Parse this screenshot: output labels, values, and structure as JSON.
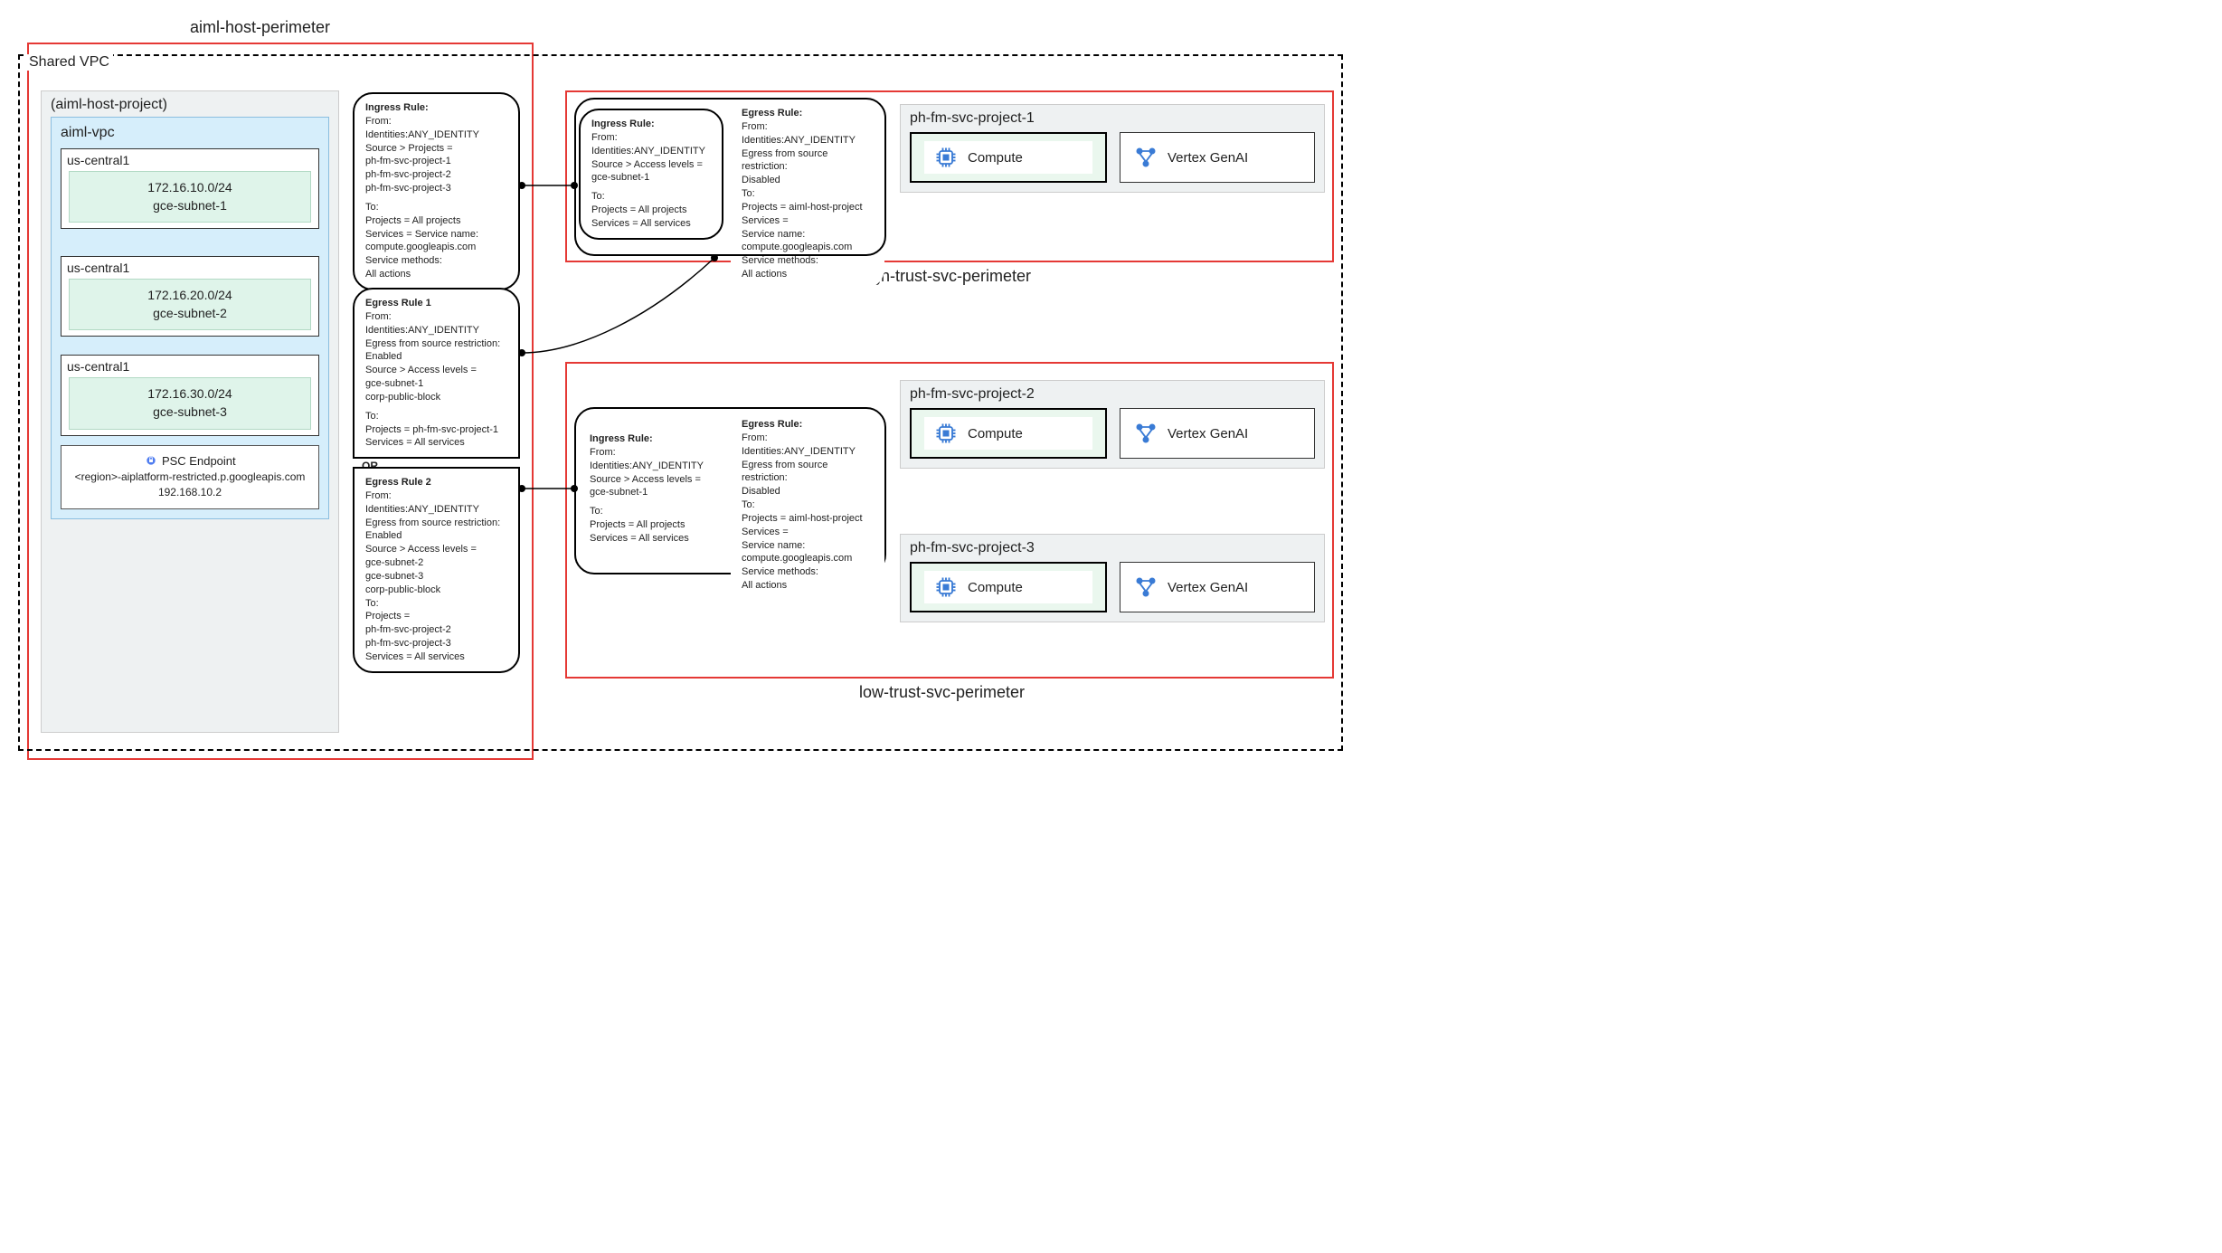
{
  "perimeters": {
    "host_label": "aiml-host-perimeter",
    "high_trust_label": "high-trust-svc-perimeter",
    "low_trust_label": "low-trust-svc-perimeter"
  },
  "shared_vpc": {
    "title": "Shared VPC",
    "host_project": {
      "title": "(aiml-host-project)",
      "vpc": {
        "title": "aiml-vpc",
        "subnets": [
          {
            "region": "us-central1",
            "cidr": "172.16.10.0/24",
            "name": "gce-subnet-1"
          },
          {
            "region": "us-central1",
            "cidr": "172.16.20.0/24",
            "name": "gce-subnet-2"
          },
          {
            "region": "us-central1",
            "cidr": "172.16.30.0/24",
            "name": "gce-subnet-3"
          }
        ],
        "psc": {
          "title": "PSC Endpoint",
          "host": "<region>-aiplatform-restricted.p.googleapis.com",
          "ip": "192.168.10.2"
        }
      }
    }
  },
  "rules": {
    "host_ingress": {
      "heading": "Ingress Rule:",
      "lines": [
        "From:",
        "Identities:ANY_IDENTITY",
        "Source > Projects =",
        "ph-fm-svc-project-1",
        "ph-fm-svc-project-2",
        "ph-fm-svc-project-3",
        "",
        "To:",
        "Projects = All projects",
        "Services = Service name:",
        "compute.googleapis.com",
        "Service methods:",
        "All actions"
      ]
    },
    "host_egress_1": {
      "heading": "Egress Rule 1",
      "lines": [
        "From:",
        "Identities:ANY_IDENTITY",
        "Egress from source restriction:",
        "Enabled",
        "Source > Access levels =",
        "gce-subnet-1",
        "corp-public-block",
        "",
        "To:",
        "Projects = ph-fm-svc-project-1",
        "Services = All services"
      ]
    },
    "or_label": "OR",
    "host_egress_2": {
      "heading": "Egress Rule 2",
      "lines": [
        "From:",
        "Identities:ANY_IDENTITY",
        "Egress from source restriction:",
        "Enabled",
        "Source > Access levels =",
        "gce-subnet-2",
        "gce-subnet-3",
        "corp-public-block",
        "To:",
        "Projects =",
        "ph-fm-svc-project-2",
        "ph-fm-svc-project-3",
        "Services = All services"
      ]
    },
    "high_ingress": {
      "heading": "Ingress Rule:",
      "lines": [
        "From:",
        "Identities:ANY_IDENTITY",
        "Source > Access levels =",
        "gce-subnet-1",
        "",
        "To:",
        "Projects = All projects",
        "Services = All services"
      ]
    },
    "high_egress": {
      "heading": "Egress Rule:",
      "lines": [
        "From:",
        "Identities:ANY_IDENTITY",
        "Egress from source restriction:",
        "Disabled",
        "To:",
        "Projects = aiml-host-project",
        "Services =",
        "Service name:",
        "compute.googleapis.com",
        "Service methods:",
        "All actions"
      ]
    },
    "low_ingress": {
      "heading": "Ingress Rule:",
      "lines": [
        "From:",
        "Identities:ANY_IDENTITY",
        "Source > Access levels =",
        "gce-subnet-1",
        "",
        "To:",
        "Projects = All projects",
        "Services = All services"
      ]
    },
    "low_egress": {
      "heading": "Egress Rule:",
      "lines": [
        "From:",
        "Identities:ANY_IDENTITY",
        "Egress from source restriction:",
        "Disabled",
        "To:",
        "Projects = aiml-host-project",
        "Services =",
        "Service name:",
        "compute.googleapis.com",
        "Service methods:",
        "All actions"
      ]
    }
  },
  "svc_projects": {
    "p1": {
      "title": "ph-fm-svc-project-1",
      "compute": "Compute",
      "vertex": "Vertex GenAI"
    },
    "p2": {
      "title": "ph-fm-svc-project-2",
      "compute": "Compute",
      "vertex": "Vertex GenAI"
    },
    "p3": {
      "title": "ph-fm-svc-project-3",
      "compute": "Compute",
      "vertex": "Vertex GenAI"
    }
  },
  "icons": {
    "compute": "compute-icon",
    "vertex": "vertex-icon",
    "psc": "psc-lock-icon"
  }
}
